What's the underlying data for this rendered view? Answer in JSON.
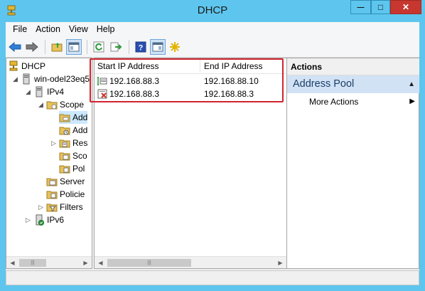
{
  "window": {
    "title": "DHCP",
    "minimize_glyph": "—",
    "maximize_glyph": "□",
    "close_glyph": "✕"
  },
  "menu": [
    "File",
    "Action",
    "View",
    "Help"
  ],
  "toolbar": {
    "icons": [
      "back-arrow-icon",
      "forward-arrow-icon",
      "up-folder-icon",
      "show-hide-tree-icon",
      "refresh-icon",
      "export-list-icon",
      "help-icon",
      "properties-pane-icon",
      "new-scope-star-icon"
    ]
  },
  "tree": {
    "root": "DHCP",
    "server": "win-odel23eq5",
    "ipv4": "IPv4",
    "scope": "Scope",
    "scope_children": [
      "Add",
      "Add",
      "Res",
      "Sco",
      "Pol"
    ],
    "server_options": "Server",
    "policies": "Policie",
    "filters": "Filters",
    "ipv6": "IPv6"
  },
  "list": {
    "columns": [
      "Start IP Address",
      "End IP Address"
    ],
    "rows": [
      {
        "start": "192.168.88.3",
        "end": "192.168.88.10",
        "type": "range"
      },
      {
        "start": "192.168.88.3",
        "end": "192.168.88.3",
        "type": "exclusion"
      }
    ]
  },
  "actions": {
    "header": "Actions",
    "section": "Address Pool",
    "items": [
      "More Actions"
    ]
  },
  "colors": {
    "title_bar": "#5ec6ee",
    "close_button": "#c7372f",
    "highlight": "#d1242f",
    "actions_section": "#d2e2f5"
  }
}
